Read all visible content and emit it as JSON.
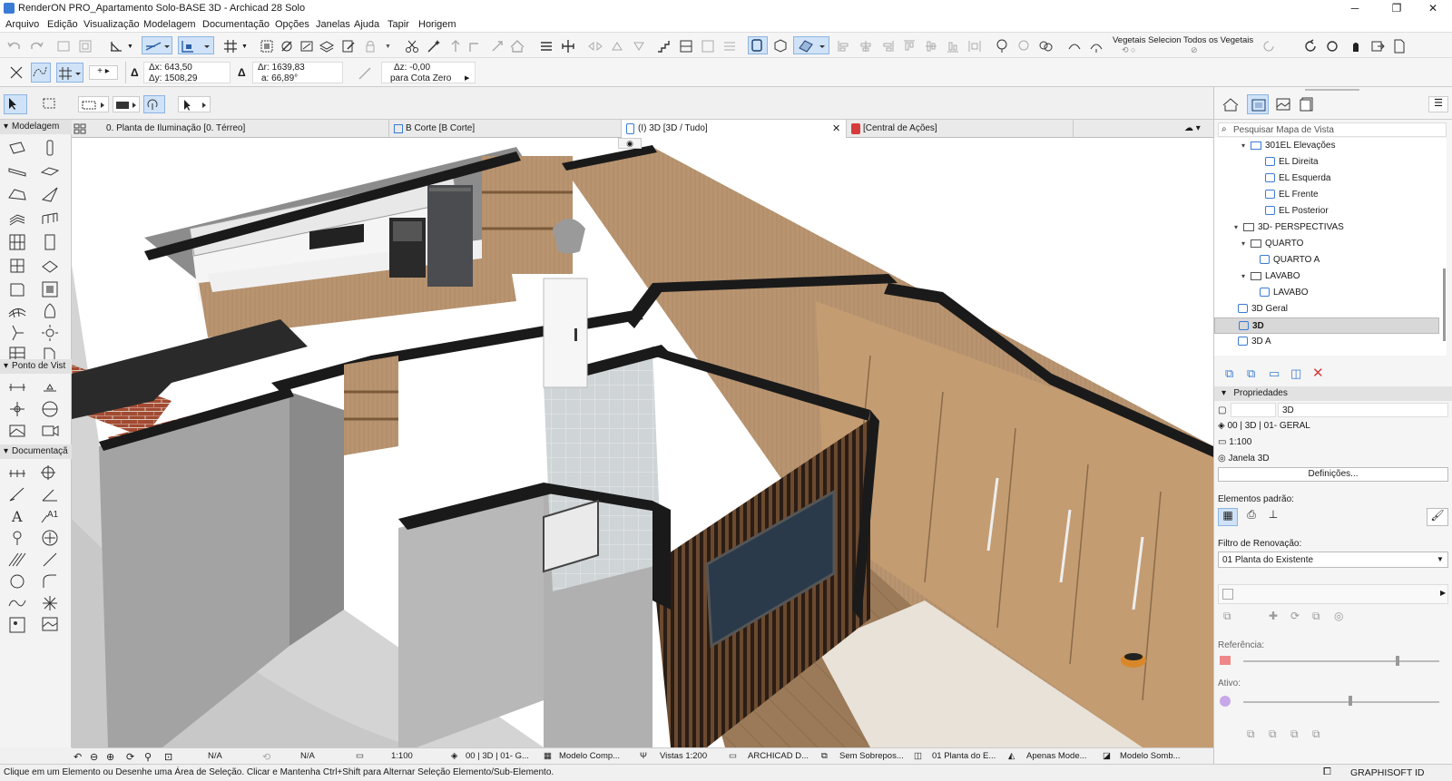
{
  "window": {
    "title": "RenderON PRO_Apartamento Solo-BASE 3D - Archicad 28 Solo",
    "minimize": "─",
    "maximize": "❐",
    "close": "✕"
  },
  "menu": [
    "Arquivo",
    "Edição",
    "Visualização",
    "Modelagem",
    "Documentação",
    "Opções",
    "Janelas",
    "Ajuda",
    "Tapir",
    "Horigem"
  ],
  "toolbar": {
    "veg_sel_label": "Vegetais Selecion",
    "all_veg_label": "Todos os Vegetais"
  },
  "infobar": {
    "dx": "Δx: 643,50",
    "dy": "Δy: 1508,29",
    "dr": "Δr: 1639,83",
    "angle": "a: 66,89°",
    "dz": "Δz: -0,00",
    "zref": "para Cota Zero"
  },
  "left_panel": {
    "sections": [
      "Modelagem",
      "Ponto de Vist",
      "Documentaçã"
    ]
  },
  "tabs": [
    {
      "label": "0. Planta de Iluminação [0. Térreo]"
    },
    {
      "label": "B Corte [B Corte]"
    },
    {
      "label": "(I) 3D [3D / Tudo]"
    },
    {
      "label": "[Central de Ações]"
    }
  ],
  "statusbar": {
    "na1": "N/A",
    "na2": "N/A",
    "scale": "1:100",
    "layer_combo": "00 | 3D | 01- G...",
    "model_view": "Modelo Comp...",
    "views_scale": "Vistas 1:200",
    "pen_set": "ARCHICAD D...",
    "overrides": "Sem Sobrepos...",
    "renovation": "01 Planta do E...",
    "model_only": "Apenas Mode...",
    "shadow_model": "Modelo Somb..."
  },
  "status_message": "Clique em um Elemento ou Desenhe uma Área de Seleção. Clicar e Mantenha Ctrl+Shift para Alternar Seleção Elemento/Sub-Elemento.",
  "graphisoft_id": "GRAPHISOFT ID",
  "navigator": {
    "search_placeholder": "Pesquisar Mapa de Vista",
    "items": [
      {
        "label": "301EL Elevações",
        "type": "folder"
      },
      {
        "label": "EL Direita",
        "type": "view"
      },
      {
        "label": "EL Esquerda",
        "type": "view"
      },
      {
        "label": "EL Frente",
        "type": "view"
      },
      {
        "label": "EL Posterior",
        "type": "view"
      },
      {
        "label": "3D- PERSPECTIVAS",
        "type": "folder"
      },
      {
        "label": "QUARTO",
        "type": "folder"
      },
      {
        "label": "QUARTO A",
        "type": "view"
      },
      {
        "label": "LAVABO",
        "type": "folder"
      },
      {
        "label": "LAVABO",
        "type": "view"
      },
      {
        "label": "3D Geral",
        "type": "view"
      },
      {
        "label": "3D",
        "type": "view",
        "selected": true
      },
      {
        "label": "3D A",
        "type": "view"
      }
    ]
  },
  "properties": {
    "header": "Propriedades",
    "id_value": "3D",
    "layer": "00 | 3D | 01- GERAL",
    "scale": "1:100",
    "window": "Janela 3D",
    "settings_button": "Definições...",
    "default_elements": "Elementos padrão:",
    "renovation_label": "Filtro de Renovação:",
    "renovation_value": "01 Planta do Existente",
    "reference_label": "Referência:",
    "active_label": "Ativo:"
  },
  "colors": {
    "accent": "#3a7bd5",
    "selected_row": "#d8d8d8",
    "delete_red": "#d83b3b"
  }
}
